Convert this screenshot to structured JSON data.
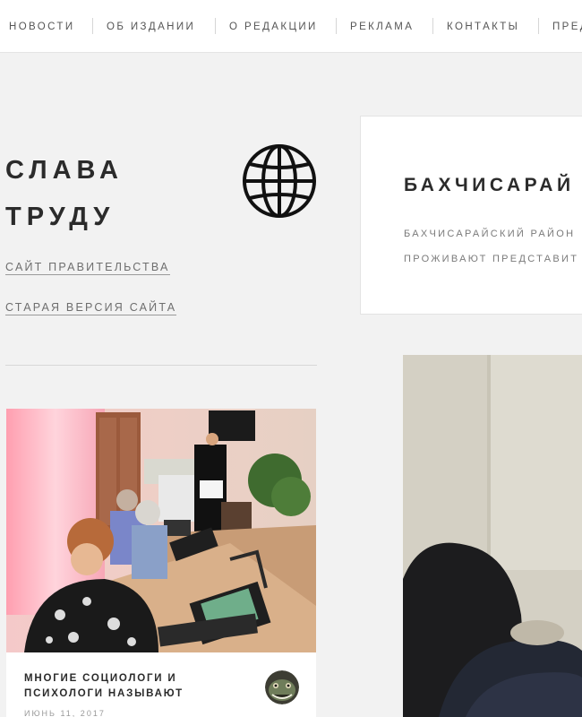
{
  "nav": {
    "items": [
      "НОВОСТИ",
      "ОБ ИЗДАНИИ",
      "О РЕДАКЦИИ",
      "РЕКЛАМА",
      "КОНТАКТЫ",
      "ПРЕД"
    ]
  },
  "site": {
    "title_line1": "СЛАВА",
    "title_line2": "ТРУДУ",
    "logo_icon": "globe-icon"
  },
  "sidebar": {
    "links": [
      "САЙТ ПРАВИТЕЛЬСТВА",
      "СТАРАЯ ВЕРСИЯ САЙТА"
    ]
  },
  "card": {
    "title_line1": "МНОГИЕ СОЦИОЛОГИ И",
    "title_line2": "ПСИХОЛОГИ НАЗЫВАЮТ",
    "date": "ИЮНЬ 11, 2017"
  },
  "main": {
    "title": "БАХЧИСАРАЙ",
    "excerpt_line1": "БАХЧИСАРАЙСКИЙ РАЙОН",
    "excerpt_line2": "ПРОЖИВАЮТ ПРЕДСТАВИТ"
  },
  "colors": {
    "background": "#f2f2f2",
    "heading": "#2b2b2b",
    "muted": "#7a7a7a"
  }
}
